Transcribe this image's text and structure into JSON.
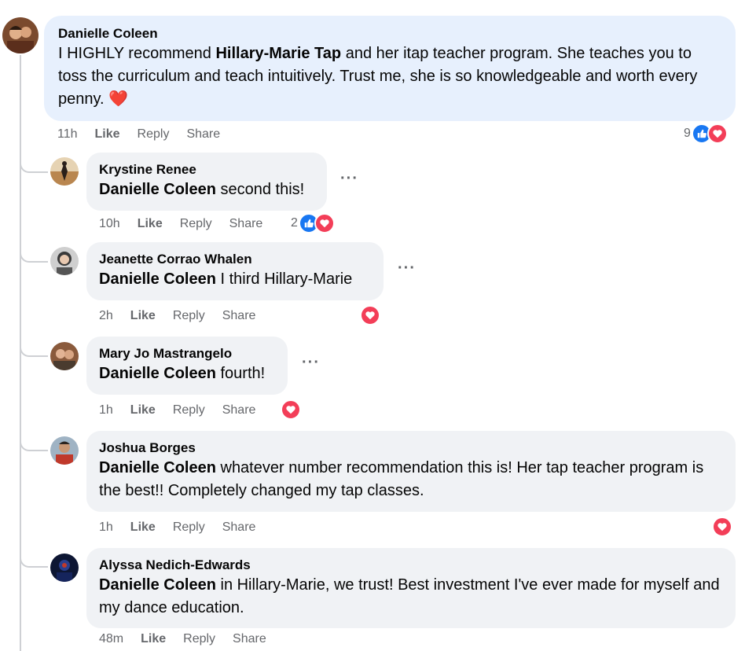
{
  "comments": [
    {
      "author": "Danielle Coleen",
      "text_before": "I HIGHLY recommend ",
      "mention": "Hillary-Marie Tap",
      "text_after": " and her itap teacher program. She teaches you to toss the curriculum and teach intuitively. Trust me, she is so knowledgeable and worth every penny. ❤️",
      "time": "11h",
      "reaction_count": "9"
    },
    {
      "author": "Krystine Renee",
      "mention": "Danielle Coleen",
      "text": " second this!",
      "time": "10h",
      "reaction_count": "2"
    },
    {
      "author": "Jeanette Corrao Whalen",
      "mention": "Danielle Coleen",
      "text": " I third Hillary-Marie",
      "time": "2h"
    },
    {
      "author": "Mary Jo Mastrangelo",
      "mention": "Danielle Coleen",
      "text": " fourth!",
      "time": "1h"
    },
    {
      "author": "Joshua Borges",
      "mention": "Danielle Coleen",
      "text": " whatever number recommendation this is! Her tap teacher program is the best!! Completely changed my tap classes.",
      "time": "1h"
    },
    {
      "author": "Alyssa Nedich-Edwards",
      "mention": "Danielle Coleen",
      "text": " in Hillary-Marie, we trust! Best investment I've ever made for myself and my dance education.",
      "time": "48m"
    }
  ],
  "actions": {
    "like": "Like",
    "reply": "Reply",
    "share": "Share"
  },
  "more": "···",
  "icons": {
    "like": "thumbs-up-icon",
    "love": "heart-icon"
  },
  "colors": {
    "like": "#1877f2",
    "love": "#f33e58",
    "main_bubble": "#e7f0fd",
    "reply_bubble": "#f0f2f5"
  }
}
